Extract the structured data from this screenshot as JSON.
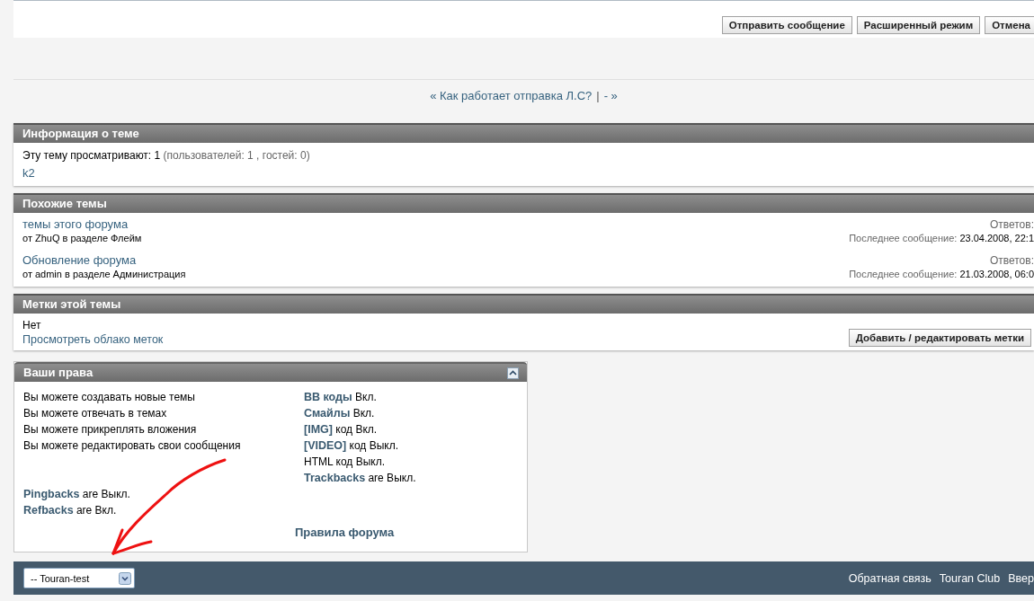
{
  "reply_buttons": [
    "Отправить сообщение",
    "Расширенный режим",
    "Отмена"
  ],
  "thread_nav": {
    "previous": "« Как работает отправка Л.С?",
    "separator": "|",
    "next": "- »"
  },
  "thread_info": {
    "title": "Информация о теме",
    "viewers": "Эту тему просматривают: 1",
    "viewers_detail": "(пользователей: 1 , гостей: 0)",
    "users": [
      "k2"
    ]
  },
  "similar_threads": {
    "title": "Похожие темы",
    "threads": [
      {
        "title": "темы этого форума",
        "meta": "от ZhuQ в разделе Флейм",
        "replies": "Ответов:",
        "last_label": "Последнее сообщение:",
        "last_date": "23.04.2008, 22:1"
      },
      {
        "title": "Обновление форума",
        "meta": "от admin в разделе Администрация",
        "replies": "Ответов:",
        "last_label": "Последнее сообщение:",
        "last_date": "21.03.2008, 06:0"
      }
    ]
  },
  "tags": {
    "title": "Метки этой темы",
    "value": "Нет",
    "cloud_link": "Просмотреть облако меток",
    "edit_button": "Добавить / редактировать метки"
  },
  "permissions": {
    "title": "Ваши права",
    "expanded": true,
    "left": [
      "Вы можете создавать новые темы",
      "Вы можете отвечать в темах",
      "Вы можете прикреплять вложения",
      "Вы можете редактировать свои сообщения"
    ],
    "right": [
      "**BB коды** Вкл.",
      "**Смайлы** Вкл.",
      "**[IMG]** код Вкл.",
      "**[VIDEO]** код Выкл.",
      "HTML код Выкл.",
      "**Trackbacks** are Выкл."
    ],
    "bottom": [
      "**Pingbacks** are Выкл.",
      "**Refbacks** are Вкл."
    ],
    "rules_link": "Правила форума"
  },
  "footer": {
    "style_select": "-- Touran-test",
    "links": [
      "Обратная связь",
      "Touran Club",
      "Ввер"
    ]
  }
}
